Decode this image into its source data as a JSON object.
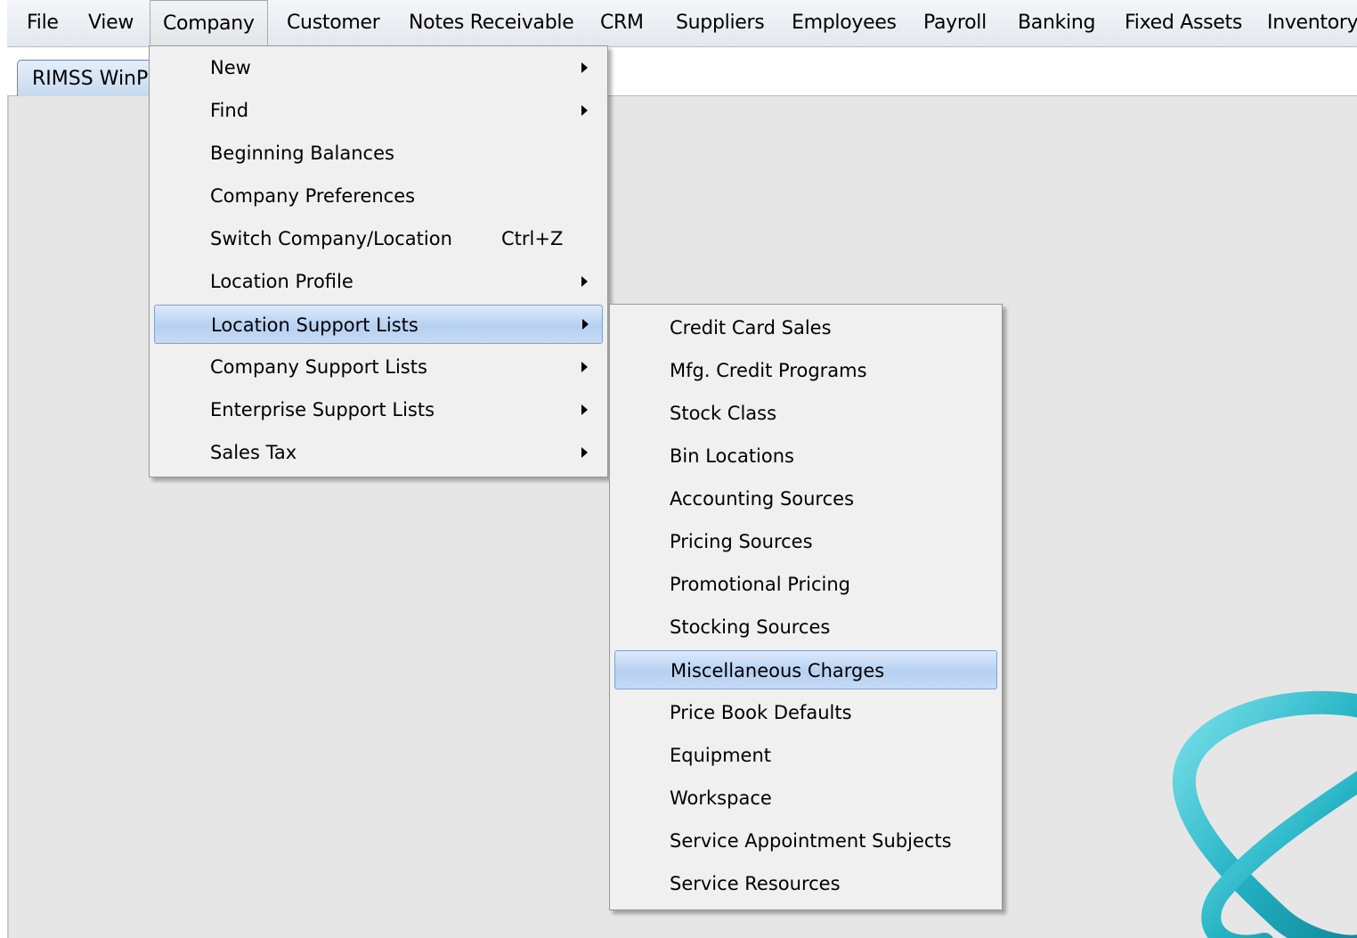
{
  "menubar": {
    "items": [
      "File",
      "View",
      "Company",
      "Customer",
      "Notes Receivable",
      "CRM",
      "Suppliers",
      "Employees",
      "Payroll",
      "Banking",
      "Fixed Assets",
      "Inventory"
    ],
    "active": "Company"
  },
  "tab": {
    "label": "RIMSS WinPOS"
  },
  "company_menu": {
    "items": [
      {
        "label": "New",
        "submenu": true
      },
      {
        "label": "Find",
        "submenu": true
      },
      {
        "label": "Beginning Balances"
      },
      {
        "label": "Company Preferences"
      },
      {
        "label": "Switch Company/Location",
        "shortcut": "Ctrl+Z"
      },
      {
        "label": "Location Profile",
        "submenu": true
      },
      {
        "label": "Location Support Lists",
        "submenu": true,
        "highlighted": true
      },
      {
        "label": "Company Support Lists",
        "submenu": true
      },
      {
        "label": "Enterprise Support Lists",
        "submenu": true
      },
      {
        "label": "Sales Tax",
        "submenu": true
      }
    ]
  },
  "location_support_menu": {
    "items": [
      {
        "label": "Credit Card Sales"
      },
      {
        "label": "Mfg. Credit Programs"
      },
      {
        "label": "Stock Class"
      },
      {
        "label": "Bin Locations"
      },
      {
        "label": "Accounting Sources"
      },
      {
        "label": "Pricing Sources"
      },
      {
        "label": "Promotional Pricing"
      },
      {
        "label": "Stocking Sources"
      },
      {
        "label": "Miscellaneous Charges",
        "highlighted": true
      },
      {
        "label": "Price Book Defaults"
      },
      {
        "label": "Equipment"
      },
      {
        "label": "Workspace"
      },
      {
        "label": "Service Appointment Subjects"
      },
      {
        "label": "Service Resources"
      }
    ]
  },
  "colors": {
    "highlight": "#c3d9f4",
    "workspace": "#e6e6e6",
    "logo": "#2fb9c9"
  },
  "icons": {
    "submenu": "submenu-arrow-icon",
    "logo": "swoosh-logo-icon"
  }
}
